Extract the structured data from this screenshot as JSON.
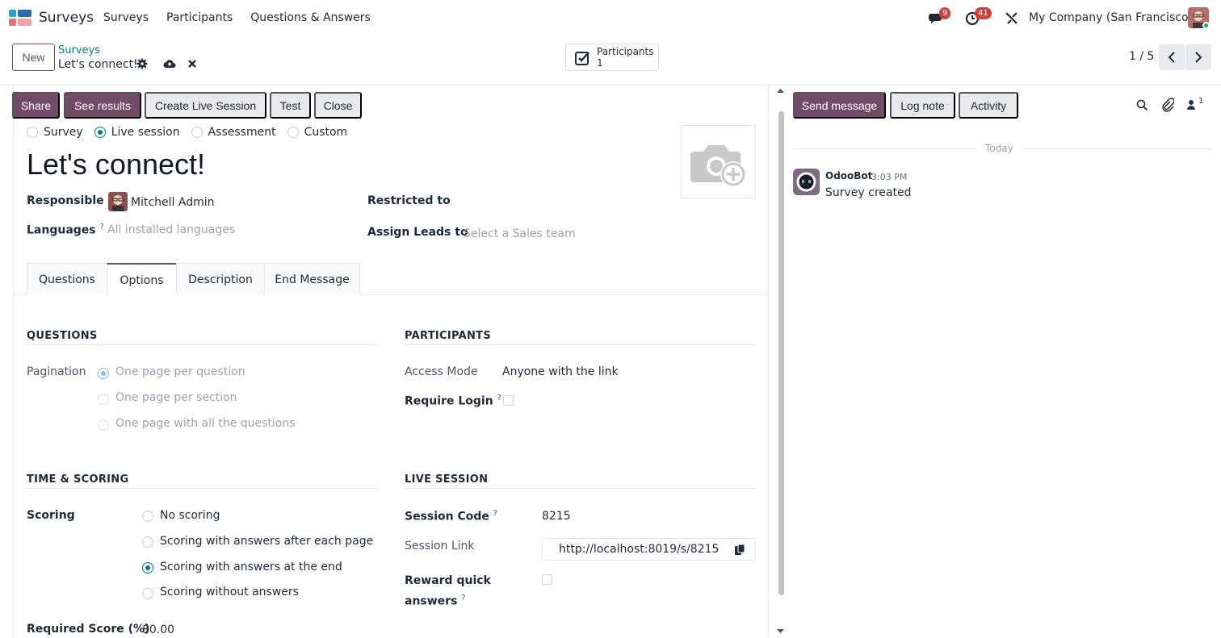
{
  "app": {
    "name": "Surveys",
    "menu": [
      "Surveys",
      "Participants",
      "Questions & Answers"
    ],
    "messages_badge": "9",
    "activities_badge": "41",
    "company": "My Company (San Francisco)"
  },
  "control_panel": {
    "new_label": "New",
    "breadcrumb": "Surveys",
    "record_title": "Let's connect!",
    "smart_button": {
      "label": "Participants",
      "value": "1"
    },
    "pager": "1 / 5"
  },
  "statusbar": {
    "buttons": [
      "Share",
      "See results",
      "Create Live Session",
      "Test",
      "Close"
    ]
  },
  "survey_type": {
    "options": [
      "Survey",
      "Live session",
      "Assessment",
      "Custom"
    ],
    "selected": "Live session"
  },
  "title": "Let's connect!",
  "fields": {
    "responsible_label": "Responsible",
    "responsible_value": "Mitchell Admin",
    "languages_label": "Languages",
    "languages_help": "?",
    "languages_placeholder": "All installed languages",
    "restricted_label": "Restricted to",
    "assign_leads_label": "Assign Leads to",
    "assign_leads_placeholder": "Select a Sales team"
  },
  "tabs": {
    "items": [
      "Questions",
      "Options",
      "Description",
      "End Message"
    ],
    "active": "Options"
  },
  "options": {
    "questions_title": "QUESTIONS",
    "pagination_label": "Pagination",
    "pagination_options": [
      "One page per question",
      "One page per section",
      "One page with all the questions"
    ],
    "participants_title": "PARTICIPANTS",
    "access_mode_label": "Access Mode",
    "access_mode_value": "Anyone with the link",
    "require_login_label": "Require Login",
    "time_scoring_title": "TIME & SCORING",
    "scoring_label": "Scoring",
    "scoring_options": [
      "No scoring",
      "Scoring with answers after each page",
      "Scoring with answers at the end",
      "Scoring without answers"
    ],
    "scoring_selected": "Scoring with answers at the end",
    "required_score_label": "Required Score (%)",
    "required_score_value": "80.00",
    "live_session_title": "LIVE SESSION",
    "session_code_label": "Session Code",
    "session_code_value": "8215",
    "session_link_label": "Session Link",
    "session_link_value": "http://localhost:8019/s/8215",
    "reward_label_1": "Reward quick",
    "reward_label_2": "answers",
    "help_mark": "?"
  },
  "chatter": {
    "send_message": "Send message",
    "log_note": "Log note",
    "activity": "Activity",
    "followers_count": "1",
    "date_separator": "Today",
    "message": {
      "author": "OdooBot",
      "time": "3:03 PM",
      "body": "Survey created"
    }
  },
  "colors": {
    "brand": "#714b67",
    "accent": "#017e84",
    "badge": "#d23f3a"
  }
}
